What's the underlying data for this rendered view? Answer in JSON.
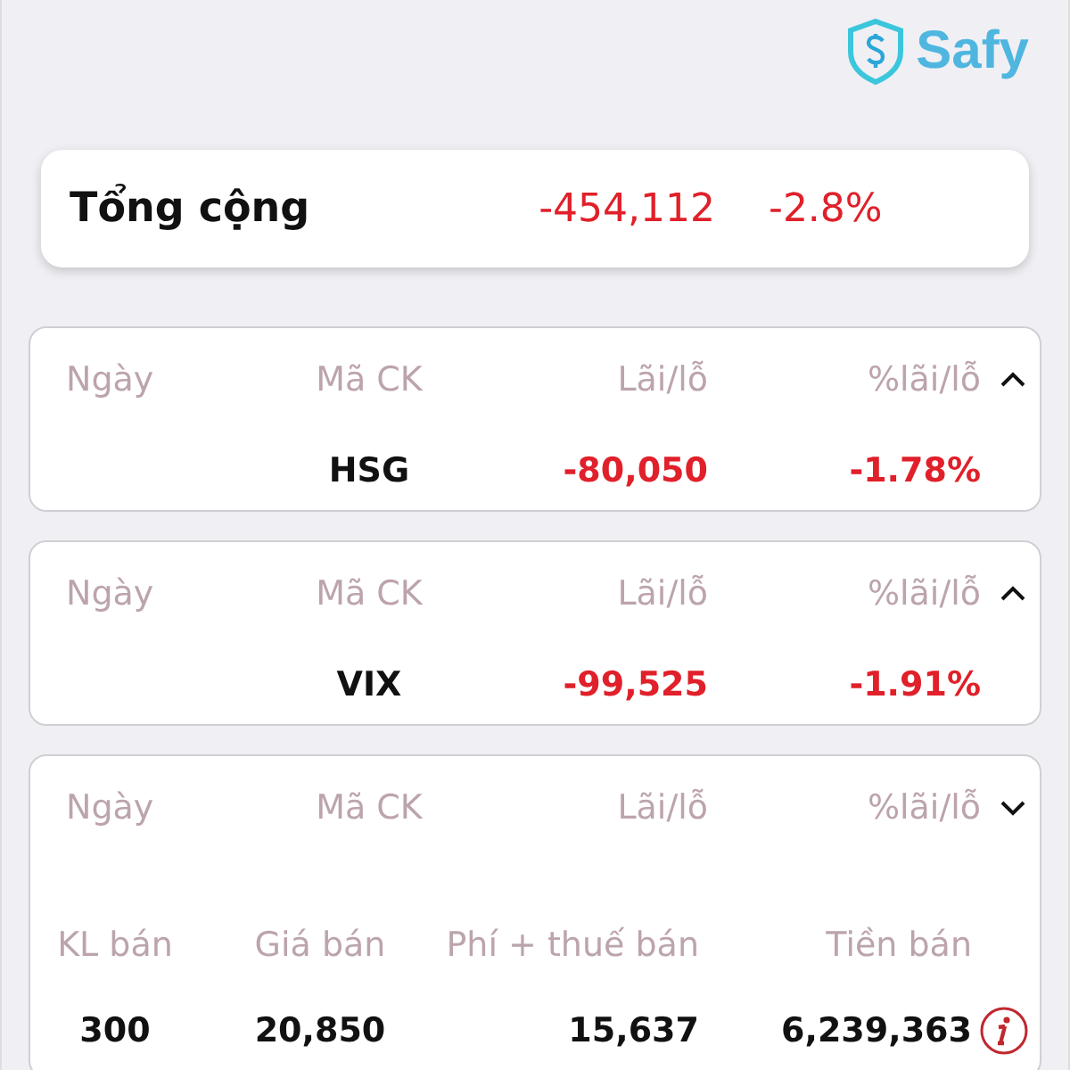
{
  "logo": {
    "text": "Safy"
  },
  "total": {
    "label": "Tổng cộng",
    "amount": "-454,112",
    "percent": "-2.8%"
  },
  "positions": [
    {
      "headers": [
        "Ngày",
        "Mã CK",
        "Lãi/lỗ",
        "%lãi/lỗ"
      ],
      "expanded": false,
      "symbol": "HSG",
      "profit": "-80,050",
      "percent": "-1.78%"
    },
    {
      "headers": [
        "Ngày",
        "Mã CK",
        "Lãi/lỗ",
        "%lãi/lỗ"
      ],
      "expanded": false,
      "symbol": "VIX",
      "profit": "-99,525",
      "percent": "-1.91%"
    },
    {
      "headers": [
        "Ngày",
        "Mã CK",
        "Lãi/lỗ",
        "%lãi/lỗ"
      ],
      "expanded": true,
      "details": {
        "headers": [
          "KL bán",
          "Giá bán",
          "Phí + thuế bán",
          "Tiền bán"
        ],
        "values": [
          "300",
          "20,850",
          "15,637",
          "6,239,363"
        ]
      }
    }
  ]
}
